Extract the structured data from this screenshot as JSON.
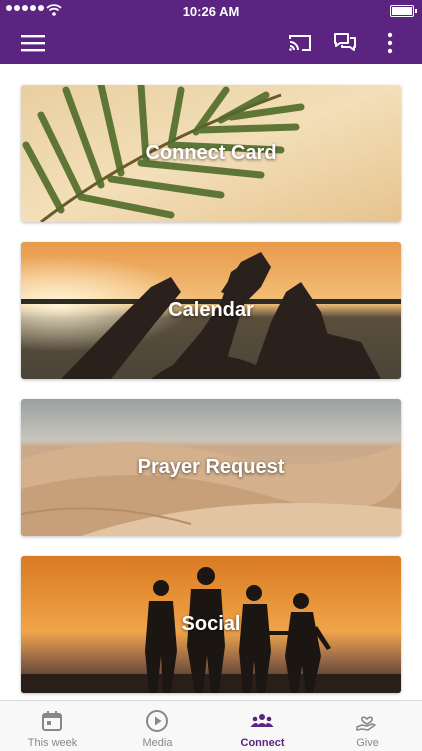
{
  "status": {
    "time": "10:26 AM"
  },
  "colors": {
    "brand": "#5b2480",
    "tab_inactive": "#888888"
  },
  "appbar": {
    "icons": [
      "menu-icon",
      "cast-icon",
      "chat-icon",
      "more-vert-icon"
    ]
  },
  "cards": [
    {
      "label": "Connect Card",
      "image": "palm-leaf"
    },
    {
      "label": "Calendar",
      "image": "heart-hands-sunset"
    },
    {
      "label": "Prayer Request",
      "image": "desert-dunes"
    },
    {
      "label": "Social",
      "image": "silhouettes-sunset"
    }
  ],
  "tabs": [
    {
      "label": "This week",
      "icon": "calendar-icon",
      "active": false
    },
    {
      "label": "Media",
      "icon": "play-circle-icon",
      "active": false
    },
    {
      "label": "Connect",
      "icon": "people-icon",
      "active": true
    },
    {
      "label": "Give",
      "icon": "giving-hand-icon",
      "active": false
    }
  ]
}
